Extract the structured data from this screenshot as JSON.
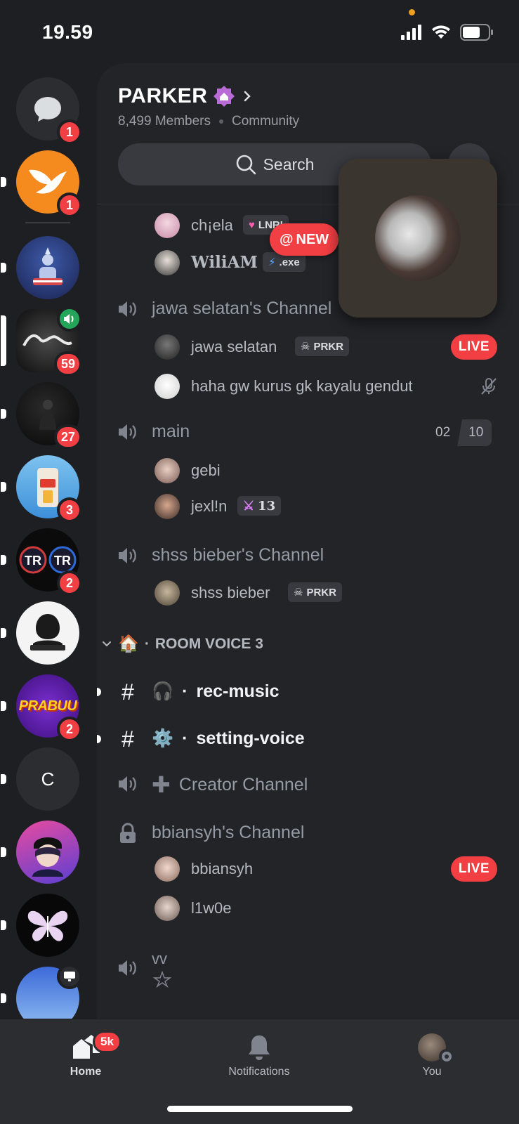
{
  "status": {
    "time": "19.59"
  },
  "server": {
    "name": "PARKER",
    "members": "8,499 Members",
    "type": "Community",
    "search_label": "Search"
  },
  "rail": {
    "items": [
      {
        "name": "direct-messages",
        "badge": "1"
      },
      {
        "name": "fox-server",
        "badge": "1"
      },
      {
        "name": "liberty-server",
        "badge": ""
      },
      {
        "name": "parker-server",
        "badge": "59"
      },
      {
        "name": "dark-server",
        "badge": "27"
      },
      {
        "name": "piwo-server",
        "badge": "3"
      },
      {
        "name": "tr-server",
        "badge": "2"
      },
      {
        "name": "syndicate-server",
        "badge": ""
      },
      {
        "name": "prabuu-server",
        "badge": "2",
        "label": "PRABUU"
      },
      {
        "name": "c-server",
        "label": "C"
      },
      {
        "name": "anime-server"
      },
      {
        "name": "butterfly-server"
      },
      {
        "name": "live-server"
      }
    ]
  },
  "channels": {
    "users_top": [
      {
        "name": "ch¡ela",
        "tag": "LNRI"
      },
      {
        "name": "WiliAM",
        "tag": ".exe"
      }
    ],
    "new_pill": "NEW",
    "vc1": {
      "name": "jawa selatan's Channel",
      "users": [
        {
          "name": "jawa selatan",
          "tag": "PRKR",
          "live": "LIVE"
        },
        {
          "name": "haha gw  kurus gk kayalu gendut"
        }
      ]
    },
    "vc2": {
      "name": "main",
      "count_a": "02",
      "count_b": "10",
      "users": [
        {
          "name": "gebi"
        },
        {
          "name": "jexl!n",
          "tag": "13"
        }
      ]
    },
    "vc3": {
      "name": "shss bieber's Channel",
      "users": [
        {
          "name": "shss bieber",
          "tag": "PRKR"
        }
      ]
    },
    "category": {
      "emoji": "🏠",
      "name": "ROOM VOICE 3"
    },
    "text1": {
      "emoji": "🎧",
      "name": "rec-music"
    },
    "text2": {
      "emoji": "⚙️",
      "name": "setting-voice"
    },
    "creator": "Creator Channel",
    "vc4": {
      "name": "bbiansyh's Channel",
      "users": [
        {
          "name": "bbiansyh",
          "live": "LIVE"
        },
        {
          "name": "l1w0e"
        }
      ]
    },
    "vc5": {
      "name": "vv"
    }
  },
  "tabs": {
    "home": "Home",
    "home_badge": "5k",
    "notifications": "Notifications",
    "you": "You"
  },
  "colors": {
    "accent_red": "#f23f43",
    "online_green": "#23a55a",
    "background": "#1e1f22"
  }
}
